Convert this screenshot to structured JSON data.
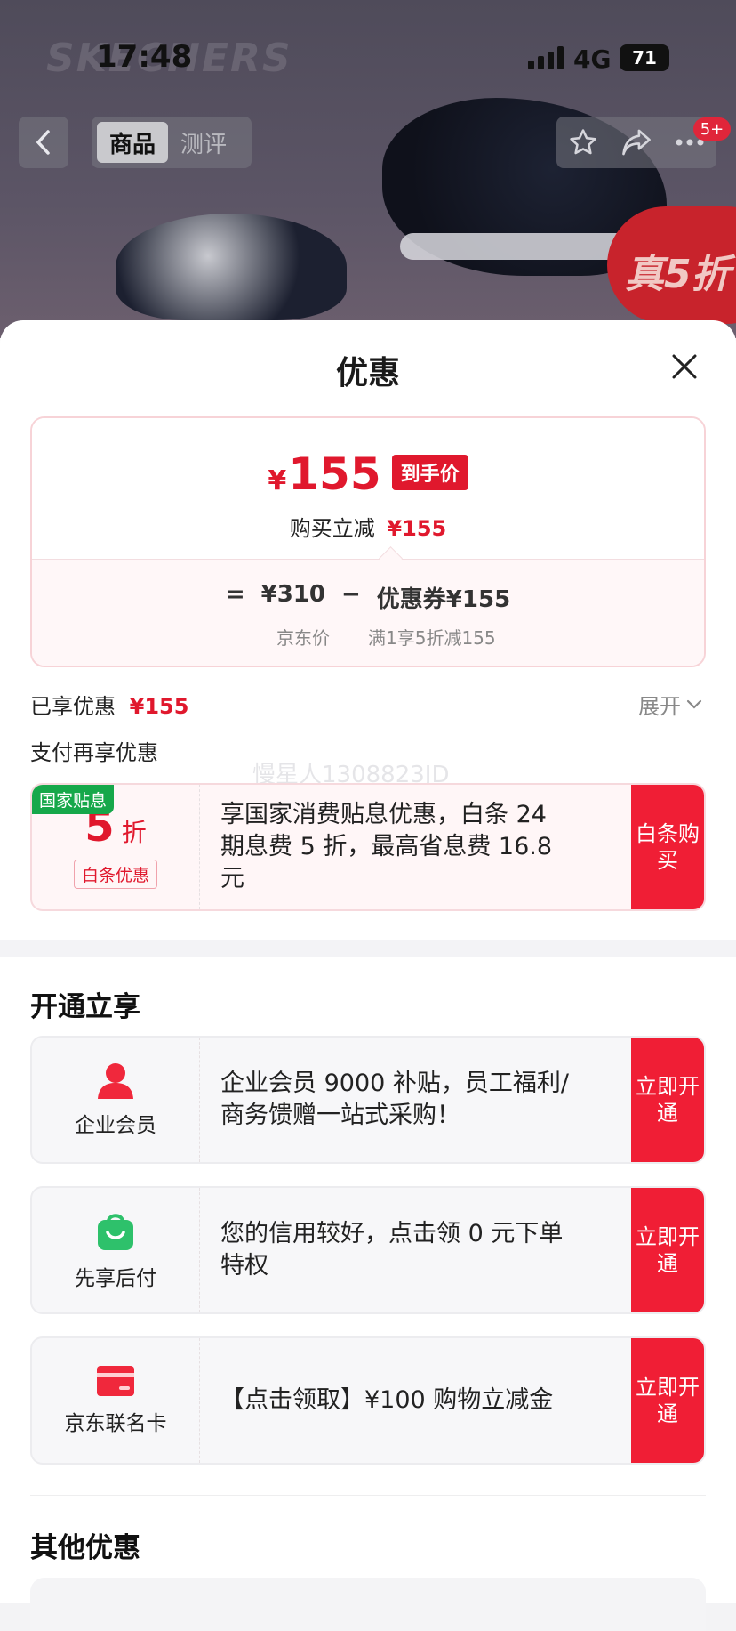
{
  "top": {
    "brand_watermark": "SKECHERS",
    "status": {
      "time": "17:48",
      "network": "4G",
      "battery": "71"
    },
    "nav": {
      "tabs": [
        "商品",
        "测评"
      ],
      "active_tab": 0,
      "cart_badge": "5+"
    },
    "promo_badge": "真5折"
  },
  "sheet": {
    "title": "优惠",
    "price": {
      "currency": "¥",
      "final_price": "155",
      "final_tag": "到手价",
      "reduce_label": "购买立减",
      "reduce_value": "¥155",
      "eq": "=",
      "jd_price": "¥310",
      "minus": "−",
      "coupon": "优惠券¥155",
      "jd_price_label": "京东价",
      "coupon_desc": "满1享5折减155"
    },
    "enjoyed_label": "已享优惠",
    "enjoyed_value": "¥155",
    "expand_label": "展开",
    "pay_more_label": "支付再享优惠",
    "watermark": "慢星人1308823JD",
    "gov_offer": {
      "tag": "国家贴息",
      "discount_num": "5",
      "discount_unit": "折",
      "sub_tag": "白条优惠",
      "text": "享国家消费贴息优惠，白条 24 期息费 5 折，最高省息费 16.8 元",
      "button": "白条购买"
    },
    "open_section_title": "开通立享",
    "open_offers": [
      {
        "icon": "person-icon",
        "label": "企业会员",
        "text": "企业会员 9000 补贴，员工福利/商务馈赠一站式采购！",
        "button": "立即开通"
      },
      {
        "icon": "shopping-bag-icon",
        "label": "先享后付",
        "text": "您的信用较好，点击领 0 元下单特权",
        "button": "立即开通"
      },
      {
        "icon": "card-icon",
        "label": "京东联名卡",
        "text": "【点击领取】¥100 购物立减金",
        "button": "立即开通"
      }
    ],
    "other_section_title": "其他优惠"
  },
  "colors": {
    "accent_red": "#e0182d",
    "button_red": "#f01e35",
    "gov_green": "#16a84a",
    "icon_green": "#2ec16b"
  }
}
